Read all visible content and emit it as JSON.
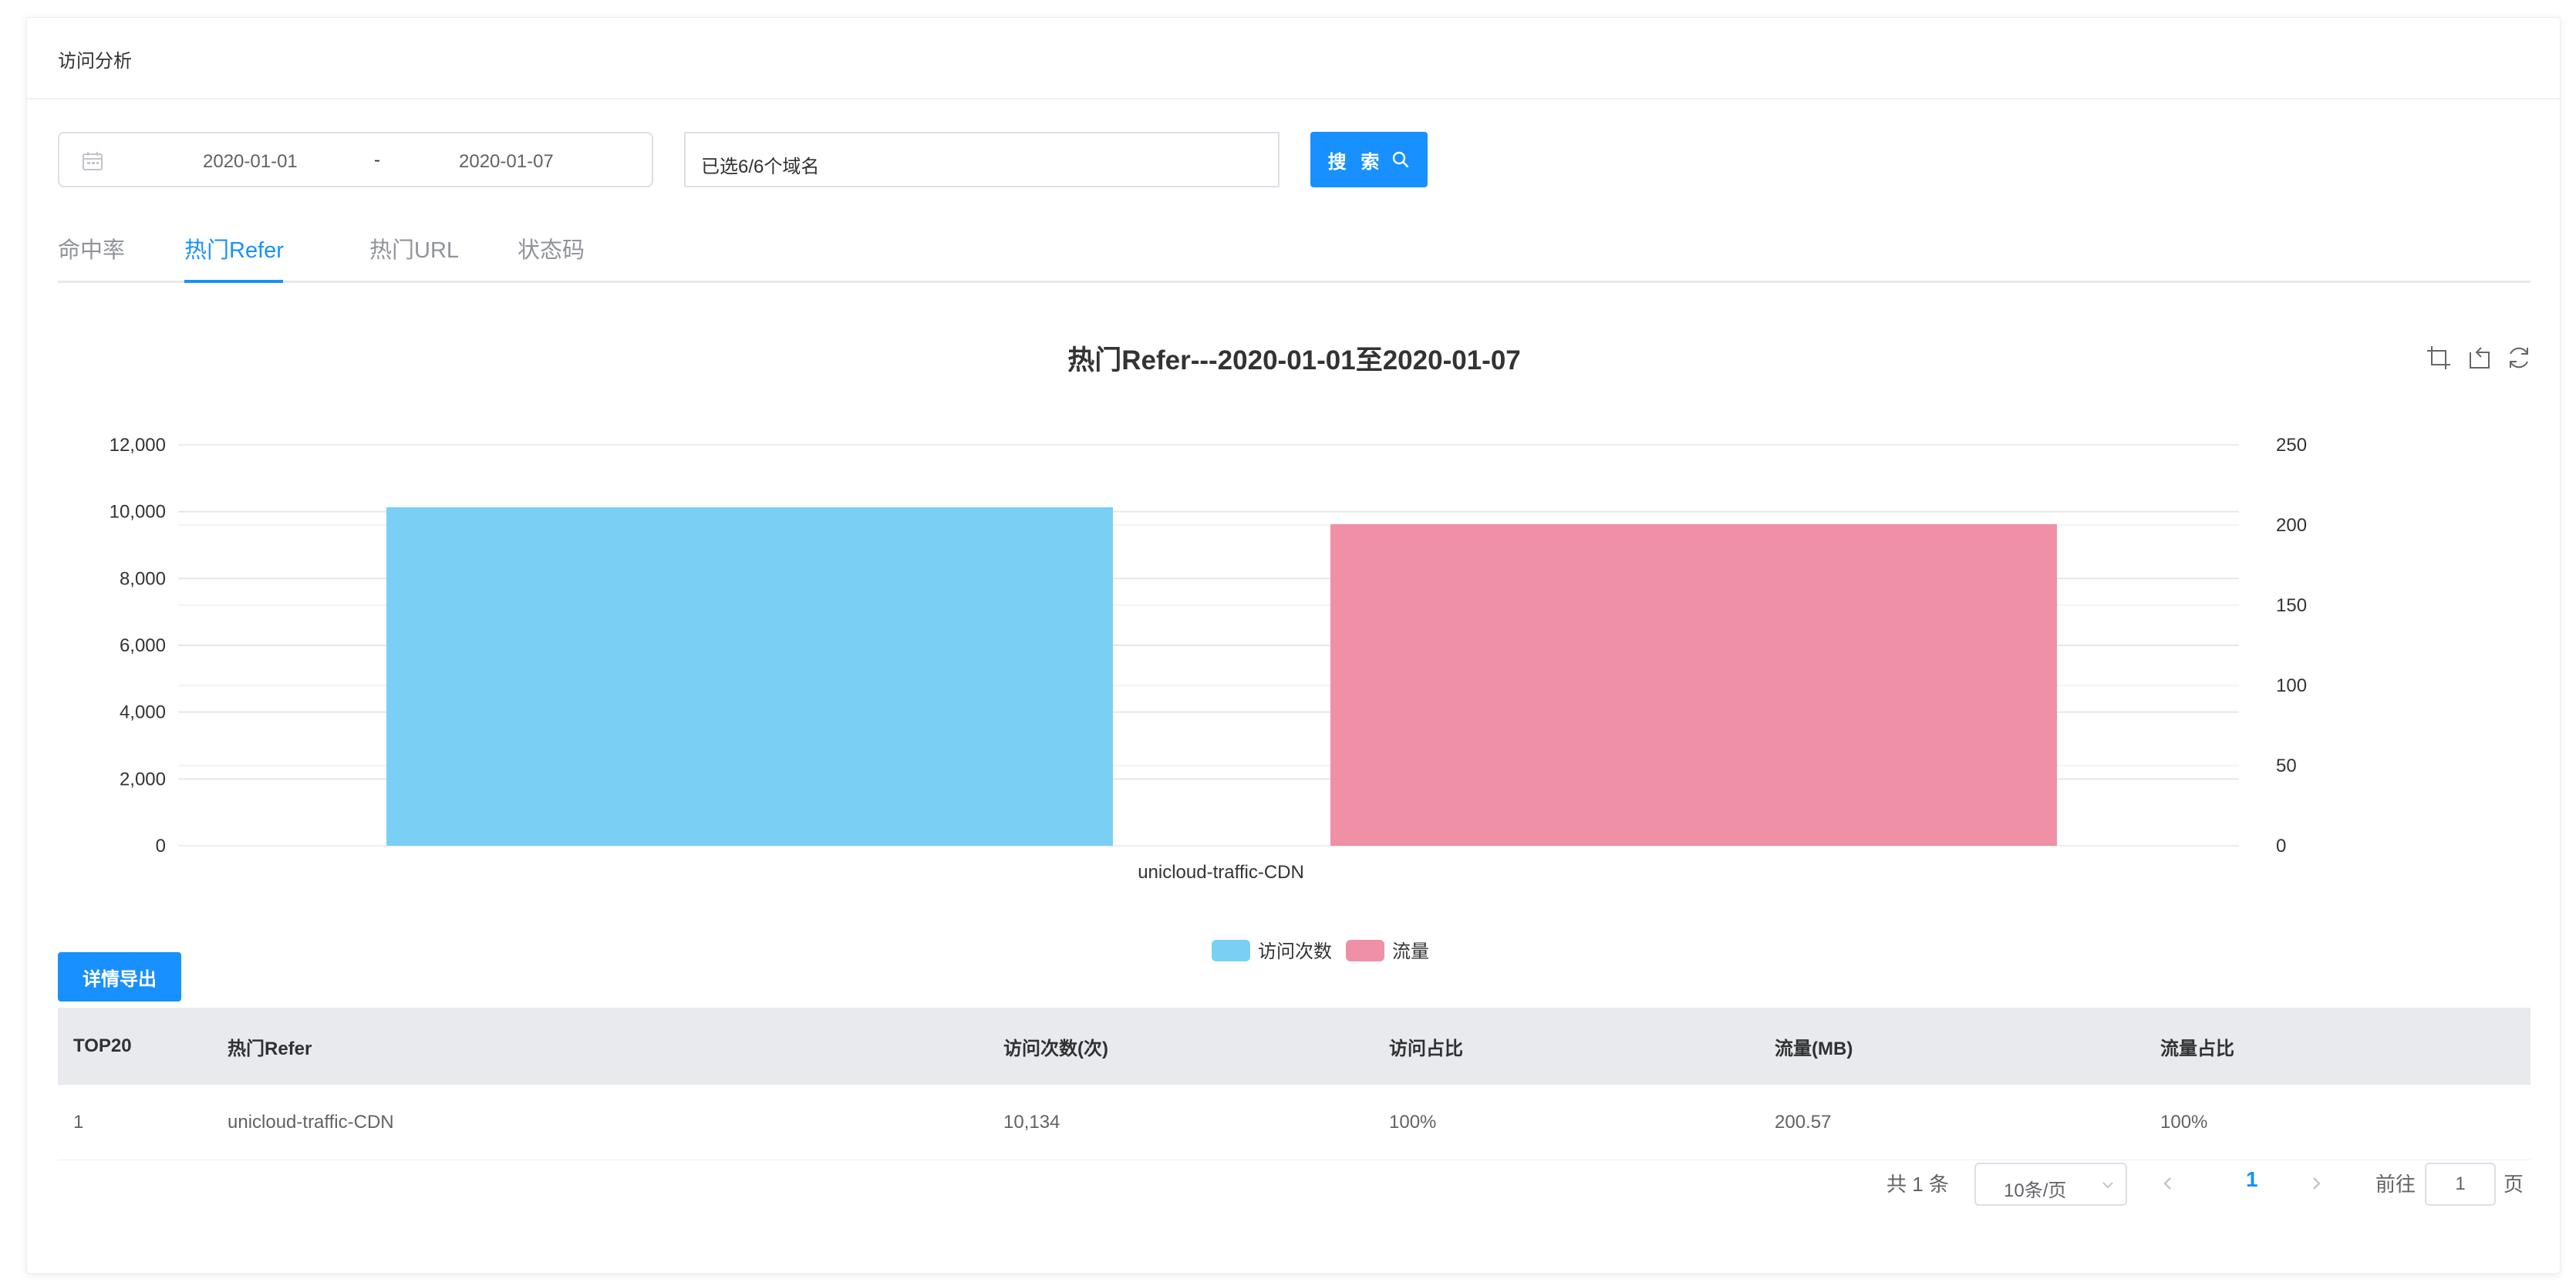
{
  "page": {
    "title": "访问分析"
  },
  "filters": {
    "date_start": "2020-01-01",
    "date_separator": "-",
    "date_end": "2020-01-07",
    "domain_selection": "已选6/6个域名",
    "search_label": "搜 索"
  },
  "tabs": [
    {
      "label": "命中率",
      "active": false
    },
    {
      "label": "热门Refer",
      "active": true
    },
    {
      "label": "热门URL",
      "active": false
    },
    {
      "label": "状态码",
      "active": false
    }
  ],
  "chart_data": {
    "type": "bar",
    "title": "热门Refer---2020-01-01至2020-01-07",
    "categories": [
      "unicloud-traffic-CDN"
    ],
    "series": [
      {
        "name": "访问次数",
        "values": [
          10134
        ],
        "axis": "left",
        "color": "#7acff5"
      },
      {
        "name": "流量",
        "values": [
          200.57
        ],
        "axis": "right",
        "color": "#ef90a6"
      }
    ],
    "y_left": {
      "ylim": [
        0,
        12000
      ],
      "ticks": [
        "0",
        "2,000",
        "4,000",
        "6,000",
        "8,000",
        "10,000",
        "12,000"
      ]
    },
    "y_right": {
      "ylim": [
        0,
        250
      ],
      "ticks": [
        "0",
        "50",
        "100",
        "150",
        "200",
        "250"
      ]
    },
    "grid": true,
    "legend_position": "bottom-center"
  },
  "toolbox": [
    "crop-icon",
    "undo-crop-icon",
    "refresh-icon"
  ],
  "export_label": "详情导出",
  "table": {
    "headers": [
      "TOP20",
      "热门Refer",
      "访问次数(次)",
      "访问占比",
      "流量(MB)",
      "流量占比"
    ],
    "rows": [
      [
        "1",
        "unicloud-traffic-CDN",
        "10,134",
        "100%",
        "200.57",
        "100%"
      ]
    ]
  },
  "pagination": {
    "total": "共 1 条",
    "page_size": "10条/页",
    "current_page": "1",
    "goto_label": "前往",
    "goto_value": "1",
    "goto_suffix": "页"
  },
  "colors": {
    "accent": "#1890ff",
    "bar1": "#7acff5",
    "bar2": "#ef90a6"
  }
}
